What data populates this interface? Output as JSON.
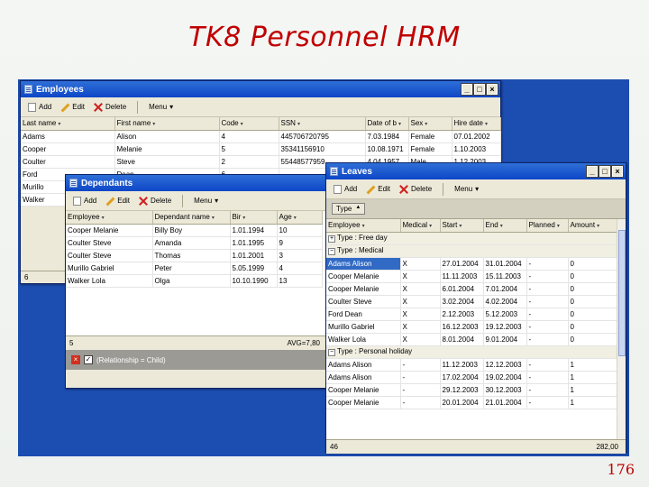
{
  "slide": {
    "title": "TK8 Personnel HRM",
    "page_number": "176",
    "accent_color": "#c00000"
  },
  "employees_window": {
    "title": "Employees",
    "toolbar": {
      "add": "Add",
      "edit": "Edit",
      "delete": "Delete",
      "menu": "Menu"
    },
    "columns": [
      "Last name",
      "First name",
      "Code",
      "SSN",
      "Date of b",
      "Sex",
      "Hire date"
    ],
    "rows": [
      [
        "Adams",
        "Alison",
        "4",
        "445706720795",
        "7.03.1984",
        "Female",
        "07.01.2002"
      ],
      [
        "Cooper",
        "Melanie",
        "5",
        "35341156910",
        "10.08.1971",
        "Female",
        "1.10.2003"
      ],
      [
        "Coulter",
        "Steve",
        "2",
        "55448577959",
        "4.04.1957",
        "Male",
        "1.12.2003"
      ],
      [
        "Ford",
        "Dean",
        "6",
        "",
        "",
        "",
        ""
      ],
      [
        "Murillo",
        "",
        "",
        "",
        "",
        "",
        ""
      ],
      [
        "Walker",
        "",
        "",
        "",
        "",
        "",
        ""
      ]
    ],
    "footer_count": "6"
  },
  "dependants_window": {
    "title": "Dependants",
    "toolbar": {
      "add": "Add",
      "edit": "Edit",
      "delete": "Delete",
      "menu": "Menu"
    },
    "columns": [
      "Employee",
      "Dependant name",
      "Bir",
      "Age"
    ],
    "rows": [
      [
        "Cooper Melanie",
        "Billy Boy",
        "1.01.1994",
        "10"
      ],
      [
        "Coulter Steve",
        "Amanda",
        "1.01.1995",
        "9"
      ],
      [
        "Coulter Steve",
        "Thomas",
        "1.01.2001",
        "3"
      ],
      [
        "Murillo Gabriel",
        "Peter",
        "5.05.1999",
        "4"
      ],
      [
        "Walker Lola",
        "Olga",
        "10.10.1990",
        "13"
      ]
    ],
    "footer_count": "5",
    "footer_avg": "AVG=7,80",
    "filter_text": "(Relationship = Child)"
  },
  "leaves_window": {
    "title": "Leaves",
    "toolbar": {
      "add": "Add",
      "edit": "Edit",
      "delete": "Delete",
      "menu": "Menu"
    },
    "group_box_label": "Type",
    "columns": [
      "Employee",
      "Medical",
      "Start",
      "End",
      "Planned",
      "Amount"
    ],
    "groups": [
      {
        "label": "Type : Free day",
        "expanded": false,
        "rows": []
      },
      {
        "label": "Type : Medical",
        "expanded": true,
        "rows": [
          [
            "Adams Alison",
            "X",
            "27.01.2004",
            "31.01.2004",
            "-",
            "0"
          ],
          [
            "Cooper Melanie",
            "X",
            "11.11.2003",
            "15.11.2003",
            "-",
            "0"
          ],
          [
            "Cooper Melanie",
            "X",
            "6.01.2004",
            "7.01.2004",
            "-",
            "0"
          ],
          [
            "Coulter Steve",
            "X",
            "3.02.2004",
            "4.02.2004",
            "-",
            "0"
          ],
          [
            "Ford Dean",
            "X",
            "2.12.2003",
            "5.12.2003",
            "-",
            "0"
          ],
          [
            "Murillo Gabriel",
            "X",
            "16.12.2003",
            "19.12.2003",
            "-",
            "0"
          ],
          [
            "Walker Lola",
            "X",
            "8.01.2004",
            "9.01.2004",
            "-",
            "0"
          ]
        ]
      },
      {
        "label": "Type : Personal holiday",
        "expanded": true,
        "rows": [
          [
            "Adams Alison",
            "-",
            "11.12.2003",
            "12.12.2003",
            "-",
            "1"
          ],
          [
            "Adams Alison",
            "-",
            "17.02.2004",
            "19.02.2004",
            "-",
            "1"
          ],
          [
            "Cooper Melanie",
            "-",
            "29.12.2003",
            "30.12.2003",
            "-",
            "1"
          ],
          [
            "Cooper Melanie",
            "-",
            "20.01.2004",
            "21.01.2004",
            "-",
            "1"
          ]
        ]
      }
    ],
    "footer_count": "46",
    "footer_sum": "282,00"
  }
}
